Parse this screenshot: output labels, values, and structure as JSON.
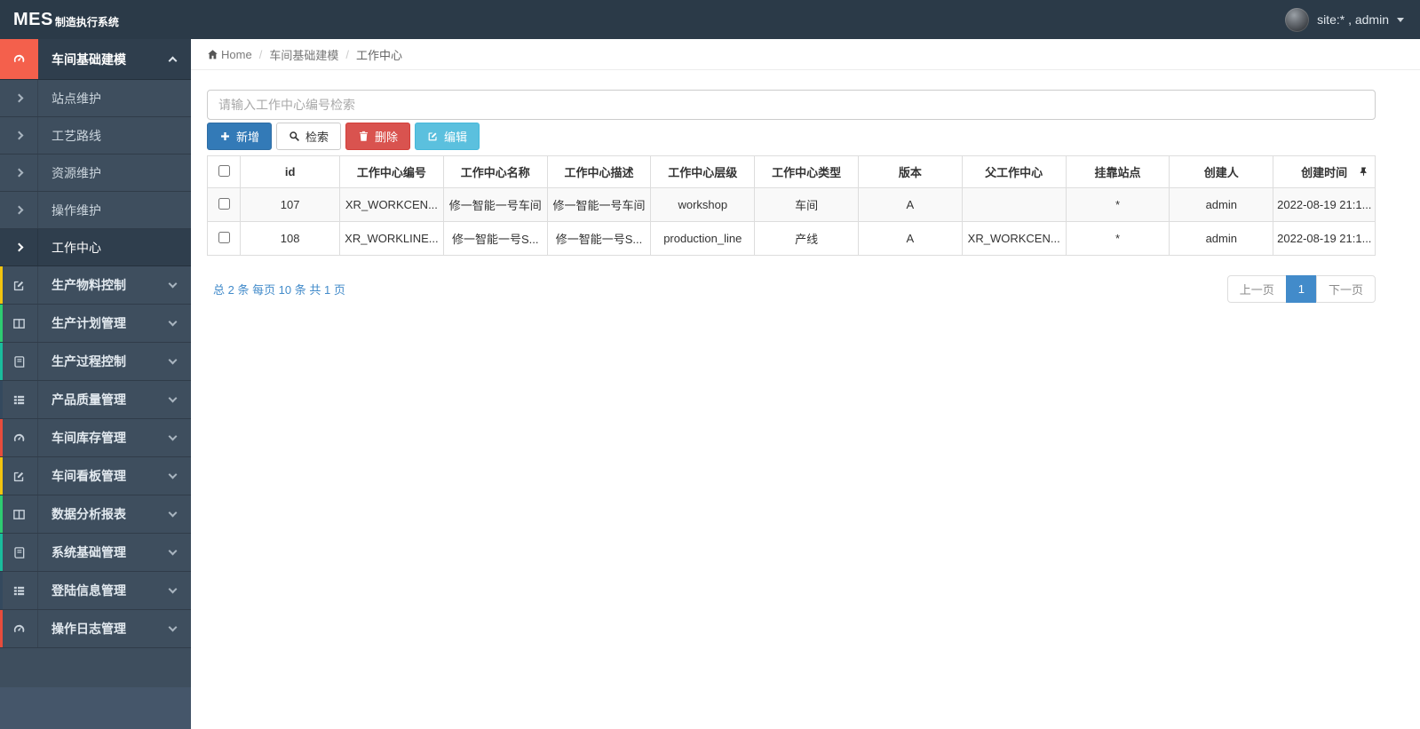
{
  "app": {
    "brand_bold": "MES",
    "brand_rest": "制造执行系统",
    "user_label": "site:* , admin"
  },
  "colors": {
    "topbar": "#2b3a48",
    "sidebar": "#3e4e5e",
    "sidebar_active": "#2f3e4d",
    "accent_red": "#f4604c",
    "strip_yellow": "#f1c40f",
    "strip_green": "#2ecc71",
    "strip_teal": "#1abc9c",
    "strip_navy": "#34495e",
    "strip_red": "#e74c3c",
    "btn_primary": "#337ab7",
    "btn_danger": "#d9534f",
    "btn_info": "#5bc0de",
    "link_blue": "#428bca"
  },
  "sidebar": {
    "section": {
      "label": "车间基础建模"
    },
    "subitems": [
      {
        "label": "站点维护"
      },
      {
        "label": "工艺路线"
      },
      {
        "label": "资源维护"
      },
      {
        "label": "操作维护"
      },
      {
        "label": "工作中心"
      }
    ],
    "items": [
      {
        "label": "生产物料控制"
      },
      {
        "label": "生产计划管理"
      },
      {
        "label": "生产过程控制"
      },
      {
        "label": "产品质量管理"
      },
      {
        "label": "车间库存管理"
      },
      {
        "label": "车间看板管理"
      },
      {
        "label": "数据分析报表"
      },
      {
        "label": "系统基础管理"
      },
      {
        "label": "登陆信息管理"
      },
      {
        "label": "操作日志管理"
      }
    ]
  },
  "breadcrumb": {
    "home": "Home",
    "level1": "车间基础建模",
    "level2": "工作中心"
  },
  "search": {
    "placeholder": "请输入工作中心编号检索",
    "value": ""
  },
  "toolbar": {
    "add": "新增",
    "search": "检索",
    "delete": "删除",
    "edit": "编辑"
  },
  "table": {
    "headers": [
      "id",
      "工作中心编号",
      "工作中心名称",
      "工作中心描述",
      "工作中心层级",
      "工作中心类型",
      "版本",
      "父工作中心",
      "挂靠站点",
      "创建人",
      "创建时间"
    ],
    "rows": [
      [
        "107",
        "XR_WORKCEN...",
        "修一智能一号车间",
        "修一智能一号车间",
        "workshop",
        "车间",
        "A",
        "",
        "*",
        "admin",
        "2022-08-19 21:1..."
      ],
      [
        "108",
        "XR_WORKLINE...",
        "修一智能一号S...",
        "修一智能一号S...",
        "production_line",
        "产线",
        "A",
        "XR_WORKCEN...",
        "*",
        "admin",
        "2022-08-19 21:1..."
      ]
    ]
  },
  "pagination": {
    "summary": "总 2 条 每页 10 条 共 1 页",
    "prev": "上一页",
    "page": "1",
    "next": "下一页"
  }
}
